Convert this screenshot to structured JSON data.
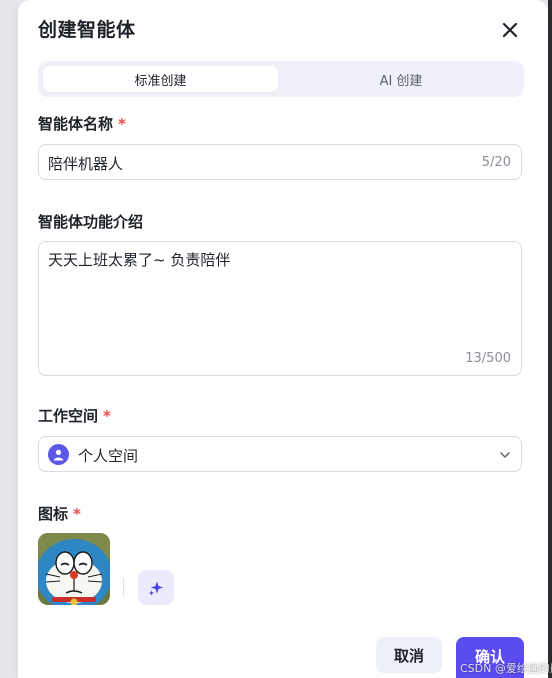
{
  "dialog": {
    "title": "创建智能体",
    "tabs": [
      {
        "label": "标准创建",
        "active": true
      },
      {
        "label": "AI 创建",
        "active": false
      }
    ]
  },
  "name_field": {
    "label": "智能体名称",
    "required_mark": "*",
    "value": "陪伴机器人",
    "counter": "5/20"
  },
  "intro_field": {
    "label": "智能体功能介绍",
    "value": "天天上班太累了~ 负责陪伴",
    "counter": "13/500"
  },
  "workspace_field": {
    "label": "工作空间",
    "required_mark": "*",
    "selected": "个人空间",
    "avatar_icon": "user-icon"
  },
  "icon_field": {
    "label": "图标",
    "required_mark": "*",
    "image_icon": "doraemon-avatar",
    "generate_icon": "sparkle-icon"
  },
  "footer": {
    "cancel_label": "取消",
    "confirm_label": "确认"
  },
  "watermark": "CSDN @爱绘画的彤姐",
  "colors": {
    "accent": "#5b4cf0",
    "required": "#f04a4a",
    "tab_bg": "#eff0f8",
    "ai_button_bg": "#ecebfd"
  }
}
